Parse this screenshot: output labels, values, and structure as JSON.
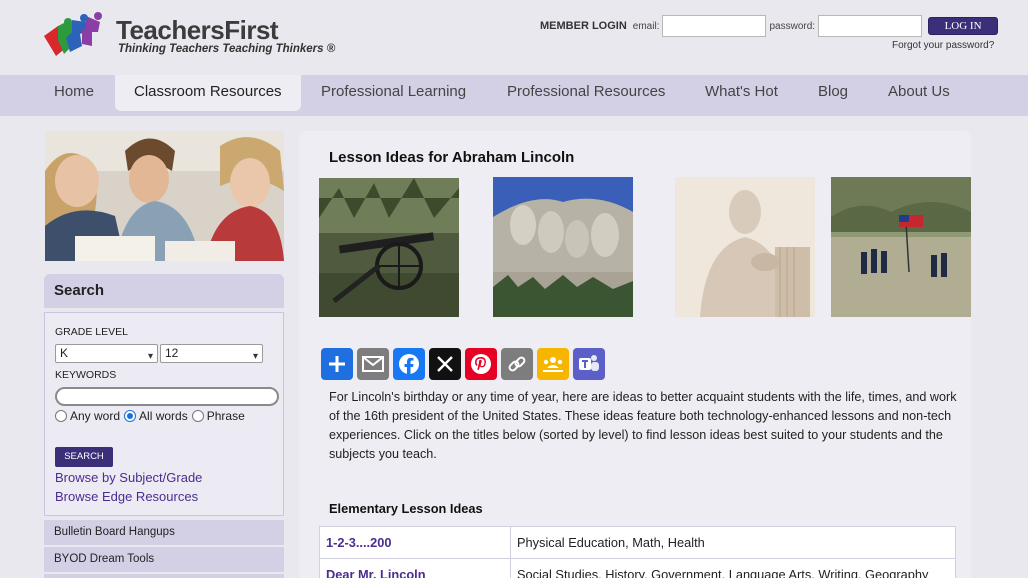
{
  "header": {
    "logo_name": "TeachersFirst",
    "logo_tagline": "Thinking Teachers Teaching Thinkers ®",
    "login_title": "MEMBER LOGIN",
    "email_label": "email:",
    "password_label": "password:",
    "login_button": "LOG IN",
    "forgot_link": "Forgot your password?"
  },
  "nav": {
    "items": [
      "Home",
      "Classroom Resources",
      "Professional Learning",
      "Professional Resources",
      "What's Hot",
      "Blog",
      "About Us"
    ],
    "active": "Classroom Resources"
  },
  "sidebar": {
    "search_title": "Search",
    "grade_label": "GRADE LEVEL",
    "grade_from": "K",
    "grade_to": "12",
    "keywords_label": "KEYWORDS",
    "keywords_value": "",
    "radio_any": "Any word",
    "radio_all": "All words",
    "radio_phrase": "Phrase",
    "radio_selected": "All words",
    "search_button": "SEARCH",
    "link_browse_subject": "Browse by Subject/Grade",
    "link_browse_edge": "Browse Edge Resources",
    "menu": [
      "Bulletin Board Hangups",
      "BYOD Dream Tools"
    ]
  },
  "main": {
    "title": "Lesson Ideas for Abraham Lincoln",
    "share_icons": [
      "share-plus-icon",
      "email-icon",
      "facebook-icon",
      "x-icon",
      "pinterest-icon",
      "copy-link-icon",
      "google-classroom-icon",
      "microsoft-teams-icon"
    ],
    "share_colors": {
      "blue": "#1f6fe0",
      "gray": "#7d7d7d",
      "facebook": "#1877f2",
      "x": "#111111",
      "pinterest": "#e60023",
      "classroom": "#f6b600",
      "teams": "#5b5fc7"
    },
    "intro": "For Lincoln's birthday or any time of year, here are ideas to better acquaint students with the life, times, and work of the 16th president of the United States. These ideas feature both technology-enhanced lessons and non-tech experiences. Click on the titles below (sorted by level) to find lesson ideas best suited to your students and the subjects you teach.",
    "section_title": "Elementary Lesson Ideas",
    "rows": [
      {
        "title": "1-2-3....200",
        "subjects": "Physical Education, Math, Health"
      },
      {
        "title": "Dear Mr. Lincoln",
        "subjects": "Social Studies, History, Government, Language Arts, Writing, Geography"
      }
    ]
  }
}
